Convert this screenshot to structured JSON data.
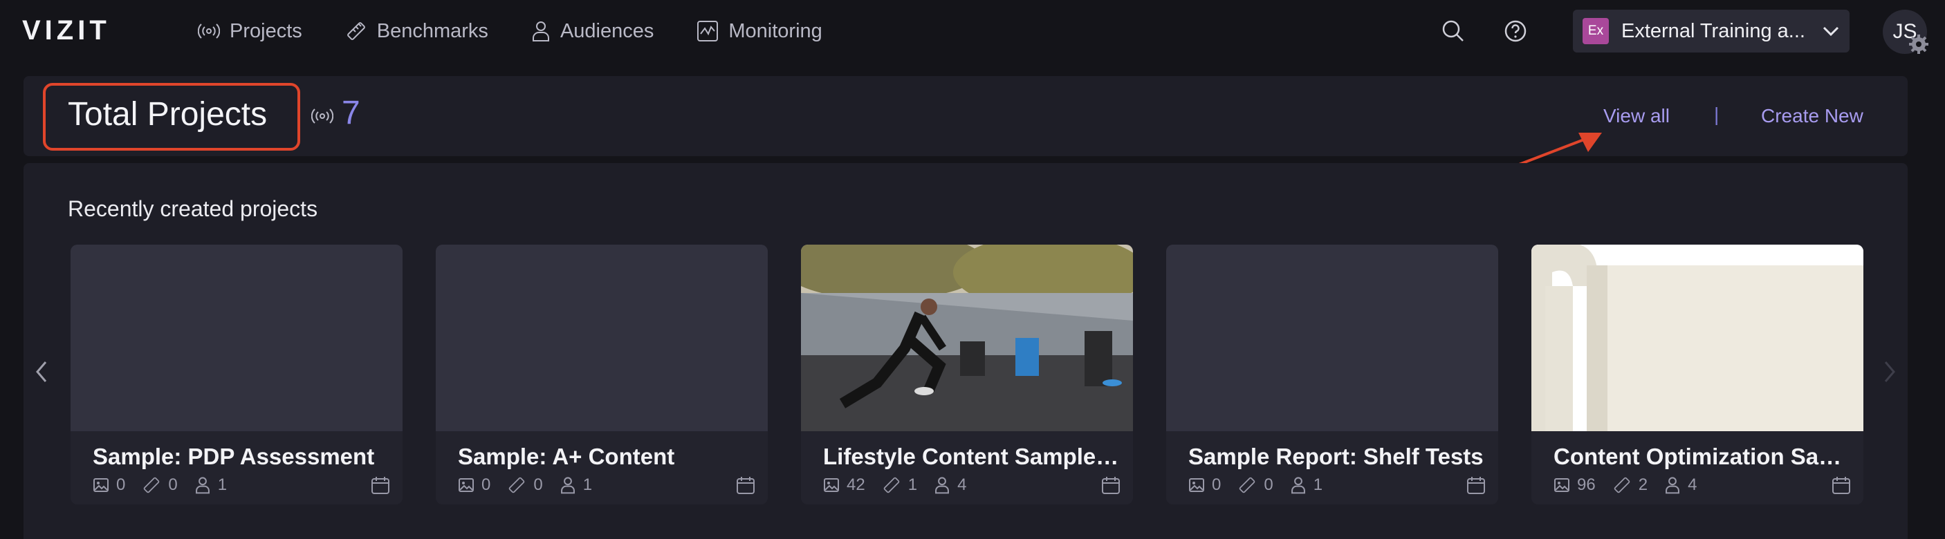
{
  "app": {
    "logo": "VIZIT"
  },
  "nav": [
    {
      "label": "Projects",
      "icon": "broadcast-icon"
    },
    {
      "label": "Benchmarks",
      "icon": "ruler-icon"
    },
    {
      "label": "Audiences",
      "icon": "person-icon"
    },
    {
      "label": "Monitoring",
      "icon": "chart-icon"
    }
  ],
  "org": {
    "badge": "Ex",
    "name": "External Training a...",
    "badge_color": "#a9489a"
  },
  "user": {
    "initials": "JS"
  },
  "header": {
    "title": "Total Projects",
    "count": "7",
    "view_all": "View all",
    "separator": "|",
    "create_new": "Create New"
  },
  "section": {
    "title": "Recently created projects"
  },
  "projects": [
    {
      "title": "Sample: PDP Assessment",
      "images": "0",
      "benchmarks": "0",
      "audiences": "1",
      "thumb": "placeholder"
    },
    {
      "title": "Sample: A+ Content",
      "images": "0",
      "benchmarks": "0",
      "audiences": "1",
      "thumb": "placeholder"
    },
    {
      "title": "Lifestyle Content Sample ...",
      "images": "42",
      "benchmarks": "1",
      "audiences": "4",
      "thumb": "photo-runner"
    },
    {
      "title": "Sample Report: Shelf Tests",
      "images": "0",
      "benchmarks": "0",
      "audiences": "1",
      "thumb": "placeholder"
    },
    {
      "title": "Content Optimization Sam...",
      "images": "96",
      "benchmarks": "2",
      "audiences": "4",
      "thumb": "photo-tumbler"
    }
  ],
  "colors": {
    "accent": "#a89cf0",
    "highlight": "#e0452b",
    "background": "#141419",
    "panel": "#1e1e27"
  }
}
